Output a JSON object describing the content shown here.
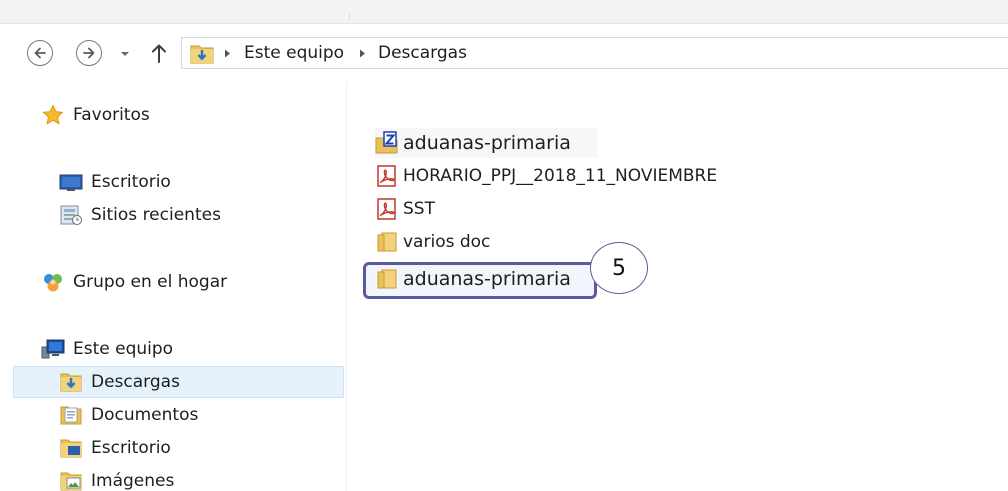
{
  "breadcrumb": [
    "Este equipo",
    "Descargas"
  ],
  "sidebar": {
    "items": [
      {
        "label": "Favoritos",
        "icon": "star-icon"
      },
      {
        "label": "Escritorio",
        "icon": "desktop-icon"
      },
      {
        "label": "Sitios recientes",
        "icon": "recent-places-icon"
      },
      {
        "label": "Grupo en el hogar",
        "icon": "homegroup-icon"
      },
      {
        "label": "Este equipo",
        "icon": "computer-icon"
      },
      {
        "label": "Descargas",
        "icon": "downloads-folder-icon",
        "selected": true
      },
      {
        "label": "Documentos",
        "icon": "documents-folder-icon"
      },
      {
        "label": "Escritorio",
        "icon": "desktop-folder-icon"
      },
      {
        "label": "Imágenes",
        "icon": "pictures-folder-icon"
      }
    ]
  },
  "files": [
    {
      "name": "aduanas-primaria",
      "icon": "zip-icon"
    },
    {
      "name": "HORARIO_PPJ__2018_11_NOVIEMBRE",
      "icon": "pdf-icon"
    },
    {
      "name": "SST",
      "icon": "pdf-icon"
    },
    {
      "name": "varios doc",
      "icon": "folder-icon"
    },
    {
      "name": "aduanas-primaria",
      "icon": "folder-icon",
      "highlighted": true
    }
  ],
  "callout_number": "5",
  "colors": {
    "highlight_border": "#5a5a9e",
    "selection": "#e5f1fb",
    "folder": "#e8c15a",
    "pdf": "#c0392b"
  }
}
